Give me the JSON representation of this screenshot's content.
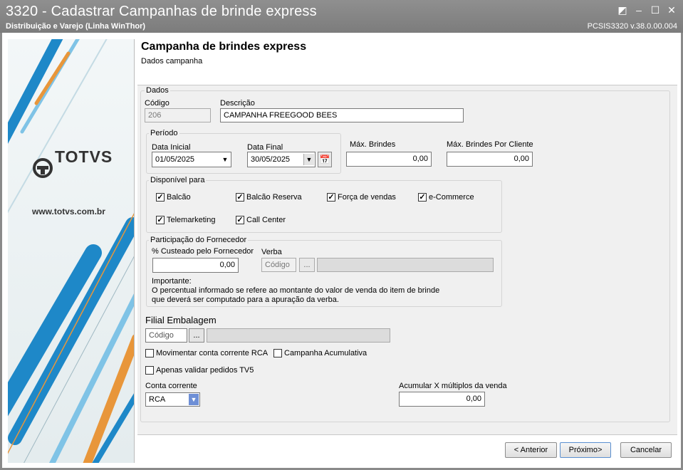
{
  "window": {
    "title": "3320 - Cadastrar Campanhas de brinde express",
    "subtitle": "Distribuição e Varejo (Linha WinThor)",
    "version": "PCSIS3320  v.38.0.00.004"
  },
  "sidebar": {
    "brand": "TOTVS",
    "url": "www.totvs.com.br"
  },
  "header": {
    "title": "Campanha de brindes express",
    "subtitle": "Dados campanha"
  },
  "dados": {
    "legend": "Dados",
    "codigo_label": "Código",
    "codigo_value": "206",
    "descricao_label": "Descrição",
    "descricao_value": "CAMPANHA FREEGOOD BEES"
  },
  "periodo": {
    "legend": "Período",
    "data_inicial_label": "Data Inicial",
    "data_inicial_value": "01/05/2025",
    "data_final_label": "Data Final",
    "data_final_value": "30/05/2025"
  },
  "brindes": {
    "max_label": "Máx. Brindes",
    "max_value": "0,00",
    "max_cliente_label": "Máx. Brindes Por Cliente",
    "max_cliente_value": "0,00"
  },
  "disponivel": {
    "legend": "Disponível para",
    "balcao": "Balcão",
    "balcao_reserva": "Balcão Reserva",
    "forca_vendas": "Força de vendas",
    "ecommerce": "e-Commerce",
    "telemarketing": "Telemarketing",
    "call_center": "Call Center",
    "check": "✓"
  },
  "fornecedor": {
    "legend": "Participação do Fornecedor",
    "custeado_label": "% Custeado pelo Fornecedor",
    "custeado_value": "0,00",
    "verba_label": "Verba",
    "verba_codigo_placeholder": "Código",
    "dots": "...",
    "importante_title": "Importante:",
    "importante_line1": "O percentual informado se refere ao montante do valor de venda do item de brinde",
    "importante_line2": "que deverá ser computado para a apuração da verba."
  },
  "filial": {
    "label": "Filial Embalagem",
    "codigo_placeholder": "Código",
    "dots": "..."
  },
  "options": {
    "movimentar_cc_rca": "Movimentar conta corrente RCA",
    "campanha_acumulativa": "Campanha Acumulativa",
    "apenas_validar_tv5": "Apenas validar pedidos TV5"
  },
  "conta": {
    "label": "Conta corrente",
    "value": "RCA",
    "acumular_label": "Acumular X múltiplos da venda",
    "acumular_value": "0,00"
  },
  "footer": {
    "anterior": "< Anterior",
    "proximo": "Próximo>",
    "cancelar": "Cancelar"
  },
  "colors": {
    "titlebar": "#8a8a8a",
    "accent_blue": "#1e88c8",
    "accent_orange": "#e8963a"
  }
}
